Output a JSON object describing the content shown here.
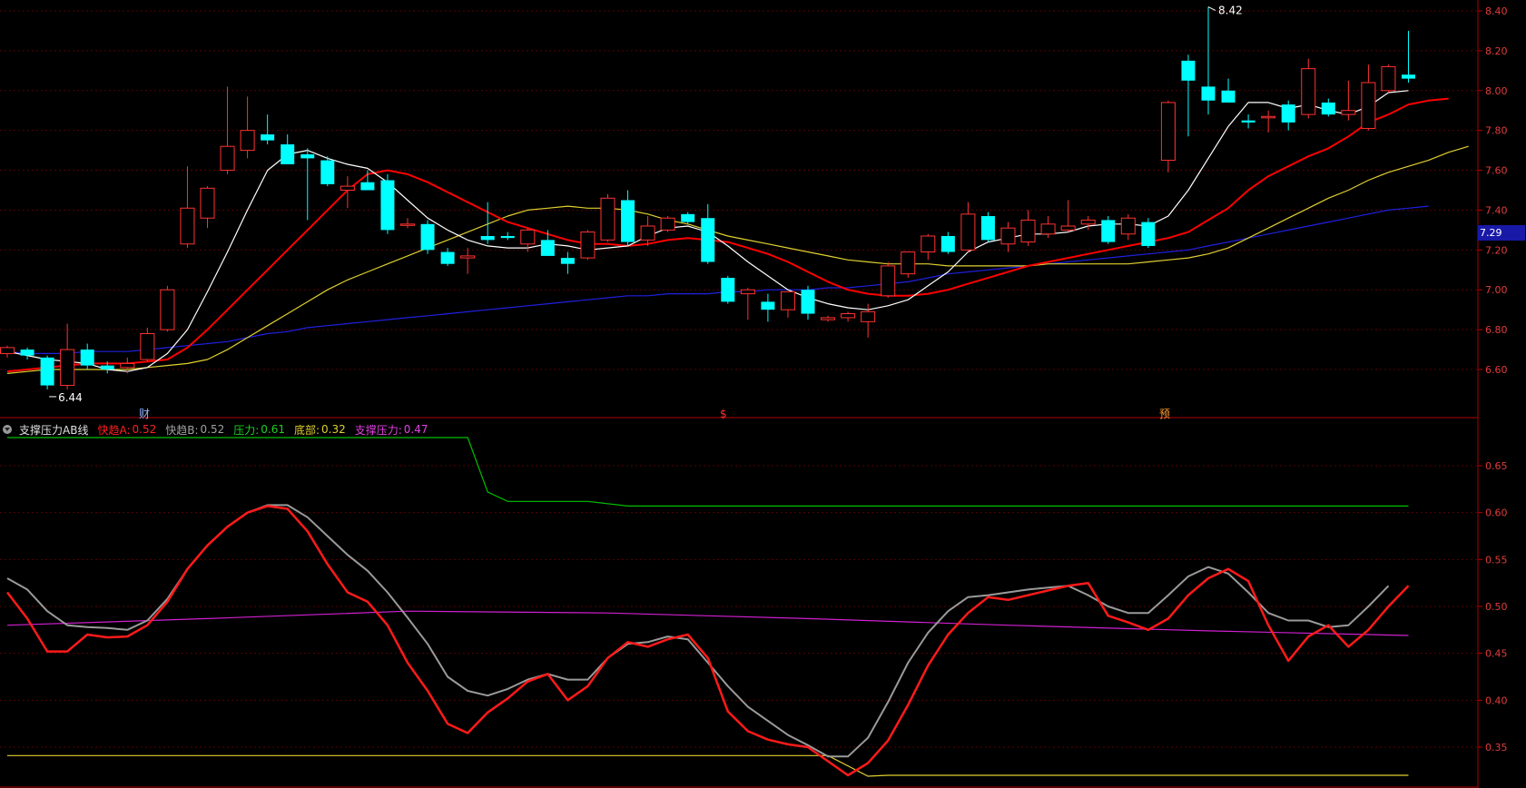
{
  "colors": {
    "background": "#000000",
    "grid": "#5a0000",
    "axis_label": "#e23c3c",
    "up_candle": "#ff3232",
    "down_candle": "#00ffff",
    "ma5": "#ffffff",
    "ma10": "#ff0000",
    "ma20": "#e0d030",
    "ma60": "#2020e0",
    "fast_a": "#ff1a1a",
    "fast_b": "#9a9a9a",
    "pressure": "#00c000",
    "bottom": "#e0d030",
    "support_pressure": "#d020d0"
  },
  "price_panel": {
    "high_marker": "8.42",
    "low_marker": "6.44",
    "current_price": "7.29",
    "event_tags": [
      "财",
      "$",
      "预"
    ],
    "y_labels": [
      "8.40",
      "8.20",
      "8.00",
      "7.80",
      "7.60",
      "7.40",
      "7.20",
      "7.00",
      "6.80",
      "6.60"
    ]
  },
  "indicator": {
    "name": "支撑压力AB线",
    "fields": [
      {
        "label": "快趋A:",
        "value": "0.52"
      },
      {
        "label": "快趋B:",
        "value": "0.52"
      },
      {
        "label": "压力:",
        "value": "0.61"
      },
      {
        "label": "底部:",
        "value": "0.32"
      },
      {
        "label": "支撑压力:",
        "value": "0.47"
      }
    ],
    "y_labels": [
      "0.65",
      "0.60",
      "0.55",
      "0.50",
      "0.45",
      "0.40",
      "0.35"
    ]
  },
  "chart_data": {
    "type": "candlestick",
    "candles": [
      [
        6.68,
        6.72,
        6.66,
        6.71
      ],
      [
        6.7,
        6.71,
        6.65,
        6.67
      ],
      [
        6.66,
        6.67,
        6.5,
        6.52
      ],
      [
        6.52,
        6.83,
        6.5,
        6.7
      ],
      [
        6.7,
        6.73,
        6.6,
        6.62
      ],
      [
        6.62,
        6.64,
        6.58,
        6.6
      ],
      [
        6.61,
        6.66,
        6.58,
        6.63
      ],
      [
        6.65,
        6.81,
        6.64,
        6.78
      ],
      [
        6.8,
        7.02,
        6.79,
        7.0
      ],
      [
        7.23,
        7.62,
        7.21,
        7.41
      ],
      [
        7.36,
        7.52,
        7.31,
        7.51
      ],
      [
        7.6,
        8.02,
        7.58,
        7.72
      ],
      [
        7.7,
        7.97,
        7.66,
        7.8
      ],
      [
        7.78,
        7.88,
        7.73,
        7.75
      ],
      [
        7.73,
        7.78,
        7.63,
        7.63
      ],
      [
        7.68,
        7.71,
        7.35,
        7.66
      ],
      [
        7.65,
        7.67,
        7.52,
        7.53
      ],
      [
        7.5,
        7.57,
        7.41,
        7.52
      ],
      [
        7.54,
        7.6,
        7.5,
        7.5
      ],
      [
        7.55,
        7.58,
        7.28,
        7.3
      ],
      [
        7.33,
        7.36,
        7.31,
        7.33
      ],
      [
        7.33,
        7.35,
        7.18,
        7.2
      ],
      [
        7.19,
        7.21,
        7.12,
        7.13
      ],
      [
        7.16,
        7.21,
        7.08,
        7.17
      ],
      [
        7.27,
        7.44,
        7.23,
        7.25
      ],
      [
        7.27,
        7.29,
        7.25,
        7.26
      ],
      [
        7.23,
        7.31,
        7.19,
        7.3
      ],
      [
        7.25,
        7.3,
        7.18,
        7.17
      ],
      [
        7.16,
        7.19,
        7.08,
        7.13
      ],
      [
        7.16,
        7.3,
        7.15,
        7.29
      ],
      [
        7.25,
        7.48,
        7.24,
        7.46
      ],
      [
        7.45,
        7.5,
        7.22,
        7.24
      ],
      [
        7.25,
        7.37,
        7.22,
        7.32
      ],
      [
        7.3,
        7.37,
        7.29,
        7.36
      ],
      [
        7.38,
        7.39,
        7.33,
        7.34
      ],
      [
        7.36,
        7.43,
        7.13,
        7.14
      ],
      [
        7.06,
        7.07,
        6.93,
        6.94
      ],
      [
        6.98,
        7.01,
        6.85,
        7.0
      ],
      [
        6.94,
        6.98,
        6.84,
        6.9
      ],
      [
        6.9,
        6.99,
        6.86,
        6.99
      ],
      [
        7.0,
        7.02,
        6.85,
        6.88
      ],
      [
        6.85,
        6.87,
        6.84,
        6.86
      ],
      [
        6.86,
        6.89,
        6.84,
        6.88
      ],
      [
        6.84,
        6.93,
        6.76,
        6.89
      ],
      [
        6.97,
        7.14,
        6.96,
        7.12
      ],
      [
        7.08,
        7.19,
        7.06,
        7.19
      ],
      [
        7.19,
        7.28,
        7.15,
        7.27
      ],
      [
        7.27,
        7.29,
        7.18,
        7.19
      ],
      [
        7.2,
        7.44,
        7.19,
        7.38
      ],
      [
        7.37,
        7.39,
        7.24,
        7.25
      ],
      [
        7.23,
        7.34,
        7.19,
        7.31
      ],
      [
        7.24,
        7.4,
        7.22,
        7.35
      ],
      [
        7.28,
        7.37,
        7.26,
        7.33
      ],
      [
        7.3,
        7.45,
        7.29,
        7.32
      ],
      [
        7.33,
        7.37,
        7.3,
        7.35
      ],
      [
        7.35,
        7.37,
        7.23,
        7.24
      ],
      [
        7.28,
        7.38,
        7.25,
        7.36
      ],
      [
        7.34,
        7.36,
        7.21,
        7.22
      ],
      [
        7.65,
        7.95,
        7.59,
        7.94
      ],
      [
        8.15,
        8.18,
        7.77,
        8.05
      ],
      [
        8.02,
        8.42,
        7.88,
        7.95
      ],
      [
        8.0,
        8.06,
        7.95,
        7.94
      ],
      [
        7.85,
        7.88,
        7.81,
        7.84
      ],
      [
        7.87,
        7.9,
        7.79,
        7.87
      ],
      [
        7.93,
        7.95,
        7.8,
        7.84
      ],
      [
        7.88,
        8.16,
        7.86,
        8.11
      ],
      [
        7.94,
        7.96,
        7.87,
        7.88
      ],
      [
        7.88,
        8.05,
        7.85,
        7.9
      ],
      [
        7.81,
        8.13,
        7.8,
        8.04
      ],
      [
        8.0,
        8.13,
        7.99,
        8.12
      ],
      [
        8.08,
        8.3,
        8.04,
        8.06
      ]
    ],
    "ma5": [
      6.69,
      6.67,
      6.65,
      6.64,
      6.63,
      6.6,
      6.59,
      6.61,
      6.68,
      6.8,
      6.99,
      7.19,
      7.4,
      7.6,
      7.68,
      7.7,
      7.66,
      7.63,
      7.61,
      7.54,
      7.45,
      7.36,
      7.3,
      7.25,
      7.22,
      7.21,
      7.21,
      7.23,
      7.22,
      7.2,
      7.21,
      7.22,
      7.27,
      7.31,
      7.32,
      7.29,
      7.22,
      7.14,
      7.07,
      7.0,
      6.96,
      6.93,
      6.91,
      6.9,
      6.92,
      6.95,
      7.02,
      7.09,
      7.19,
      7.24,
      7.26,
      7.28,
      7.28,
      7.29,
      7.32,
      7.33,
      7.33,
      7.32,
      7.37,
      7.5,
      7.66,
      7.82,
      7.94,
      7.94,
      7.91,
      7.93,
      7.9,
      7.88,
      7.92,
      7.99,
      8.0
    ],
    "ma10": [
      6.59,
      6.6,
      6.61,
      6.62,
      6.63,
      6.63,
      6.63,
      6.64,
      6.65,
      6.71,
      6.8,
      6.9,
      7.0,
      7.1,
      7.2,
      7.3,
      7.4,
      7.5,
      7.58,
      7.6,
      7.58,
      7.54,
      7.49,
      7.44,
      7.39,
      7.34,
      7.31,
      7.28,
      7.25,
      7.23,
      7.23,
      7.22,
      7.23,
      7.25,
      7.26,
      7.25,
      7.24,
      7.21,
      7.18,
      7.14,
      7.09,
      7.04,
      7.0,
      6.98,
      6.97,
      6.97,
      6.98,
      7.0,
      7.03,
      7.06,
      7.09,
      7.12,
      7.14,
      7.16,
      7.18,
      7.2,
      7.22,
      7.24,
      7.26,
      7.29,
      7.35,
      7.41,
      7.5,
      7.57,
      7.62,
      7.67,
      7.71,
      7.77,
      7.84,
      7.88,
      7.93,
      7.95,
      7.96
    ],
    "ma20": [
      6.58,
      6.59,
      6.6,
      6.6,
      6.6,
      6.6,
      6.6,
      6.61,
      6.62,
      6.63,
      6.65,
      6.7,
      6.76,
      6.82,
      6.88,
      6.94,
      7.0,
      7.05,
      7.09,
      7.13,
      7.17,
      7.21,
      7.25,
      7.29,
      7.33,
      7.37,
      7.4,
      7.41,
      7.42,
      7.41,
      7.41,
      7.4,
      7.38,
      7.35,
      7.33,
      7.3,
      7.27,
      7.25,
      7.23,
      7.21,
      7.19,
      7.17,
      7.15,
      7.14,
      7.13,
      7.13,
      7.13,
      7.12,
      7.12,
      7.12,
      7.12,
      7.12,
      7.13,
      7.13,
      7.13,
      7.13,
      7.13,
      7.14,
      7.15,
      7.16,
      7.18,
      7.21,
      7.26,
      7.31,
      7.36,
      7.41,
      7.46,
      7.5,
      7.55,
      7.59,
      7.62,
      7.65,
      7.69,
      7.72
    ],
    "ma60": [
      6.69,
      6.68,
      6.68,
      6.68,
      6.69,
      6.69,
      6.69,
      6.7,
      6.71,
      6.72,
      6.73,
      6.74,
      6.76,
      6.78,
      6.79,
      6.81,
      6.82,
      6.83,
      6.84,
      6.85,
      6.86,
      6.87,
      6.88,
      6.89,
      6.9,
      6.91,
      6.92,
      6.93,
      6.94,
      6.95,
      6.96,
      6.97,
      6.97,
      6.98,
      6.98,
      6.98,
      6.99,
      6.99,
      7.0,
      7.0,
      7.0,
      7.01,
      7.01,
      7.02,
      7.03,
      7.04,
      7.06,
      7.08,
      7.09,
      7.1,
      7.11,
      7.12,
      7.13,
      7.14,
      7.15,
      7.16,
      7.17,
      7.18,
      7.19,
      7.2,
      7.22,
      7.24,
      7.26,
      7.28,
      7.3,
      7.32,
      7.34,
      7.36,
      7.38,
      7.4,
      7.41,
      7.42
    ],
    "fast_a": [
      0.515,
      0.487,
      0.452,
      0.452,
      0.47,
      0.467,
      0.468,
      0.48,
      0.505,
      0.54,
      0.565,
      0.585,
      0.6,
      0.607,
      0.604,
      0.58,
      0.545,
      0.515,
      0.505,
      0.48,
      0.44,
      0.41,
      0.375,
      0.365,
      0.387,
      0.402,
      0.42,
      0.428,
      0.4,
      0.415,
      0.445,
      0.462,
      0.457,
      0.465,
      0.47,
      0.445,
      0.388,
      0.367,
      0.358,
      0.353,
      0.35,
      0.335,
      0.32,
      0.333,
      0.357,
      0.395,
      0.437,
      0.47,
      0.493,
      0.51,
      0.507,
      0.512,
      0.517,
      0.522,
      0.525,
      0.49,
      0.483,
      0.475,
      0.487,
      0.512,
      0.53,
      0.54,
      0.527,
      0.48,
      0.442,
      0.468,
      0.48,
      0.457,
      0.475,
      0.5,
      0.522
    ],
    "fast_b": [
      0.53,
      0.518,
      0.495,
      0.48,
      0.478,
      0.477,
      0.475,
      0.485,
      0.508,
      0.54,
      0.565,
      0.585,
      0.6,
      0.608,
      0.608,
      0.595,
      0.575,
      0.555,
      0.538,
      0.515,
      0.488,
      0.46,
      0.425,
      0.41,
      0.405,
      0.412,
      0.422,
      0.428,
      0.422,
      0.422,
      0.445,
      0.46,
      0.462,
      0.468,
      0.465,
      0.44,
      0.415,
      0.393,
      0.378,
      0.363,
      0.352,
      0.34,
      0.34,
      0.36,
      0.398,
      0.44,
      0.472,
      0.495,
      0.51,
      0.512,
      0.515,
      0.518,
      0.52,
      0.522,
      0.512,
      0.5,
      0.493,
      0.493,
      0.512,
      0.532,
      0.542,
      0.535,
      0.515,
      0.493,
      0.485,
      0.485,
      0.478,
      0.48,
      0.5,
      0.522
    ],
    "pressure": [
      [
        0,
        0.68
      ],
      [
        23,
        0.68
      ],
      [
        24,
        0.622
      ],
      [
        25,
        0.612
      ],
      [
        29,
        0.612
      ],
      [
        31,
        0.607
      ],
      [
        70,
        0.607
      ]
    ],
    "bottom": [
      [
        0,
        0.341
      ],
      [
        41,
        0.341
      ],
      [
        43,
        0.319
      ],
      [
        44,
        0.32
      ],
      [
        70,
        0.32
      ]
    ],
    "support_pressure": [
      [
        0,
        0.48
      ],
      [
        10,
        0.487
      ],
      [
        20,
        0.495
      ],
      [
        30,
        0.493
      ],
      [
        40,
        0.487
      ],
      [
        50,
        0.48
      ],
      [
        60,
        0.474
      ],
      [
        70,
        0.469
      ]
    ]
  }
}
